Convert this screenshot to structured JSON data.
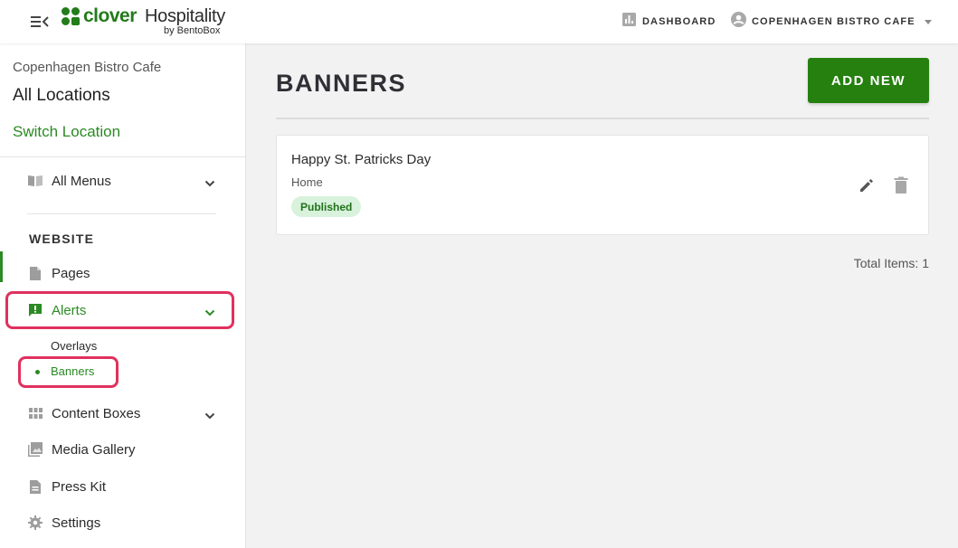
{
  "header": {
    "logo_word": "clover",
    "logo_word2": "Hospitality",
    "logo_by": "by BentoBox",
    "dashboard_label": "DASHBOARD",
    "location_label": "COPENHAGEN BISTRO CAFE",
    "icons": [
      "menu-collapse-icon",
      "clover-logo-icon",
      "bar-chart-icon",
      "account-circle-icon",
      "caret-down-icon"
    ]
  },
  "sidebar": {
    "org_name": "Copenhagen Bistro Cafe",
    "current_location": "All Locations",
    "switch_location": "Switch Location",
    "menus_label": "All Menus",
    "section_title": "WEBSITE",
    "items": [
      {
        "label": "Pages",
        "icon": "page-icon"
      },
      {
        "label": "Alerts",
        "icon": "alert-icon"
      },
      {
        "label": "Content Boxes",
        "icon": "grid-icon"
      },
      {
        "label": "Media Gallery",
        "icon": "gallery-icon"
      },
      {
        "label": "Press Kit",
        "icon": "document-icon"
      },
      {
        "label": "Settings",
        "icon": "gear-icon"
      }
    ],
    "alerts_sub": [
      "Overlays",
      "Banners"
    ]
  },
  "main": {
    "title": "BANNERS",
    "add_button": "ADD NEW",
    "banners": [
      {
        "title": "Happy St. Patricks Day",
        "page": "Home",
        "status": "Published"
      }
    ],
    "total_label": "Total Items: 1"
  },
  "colors": {
    "brand_green": "#25800f",
    "link_green": "#2b8a23",
    "highlight": "#e0315e",
    "badge_bg": "#d8f2dc"
  }
}
